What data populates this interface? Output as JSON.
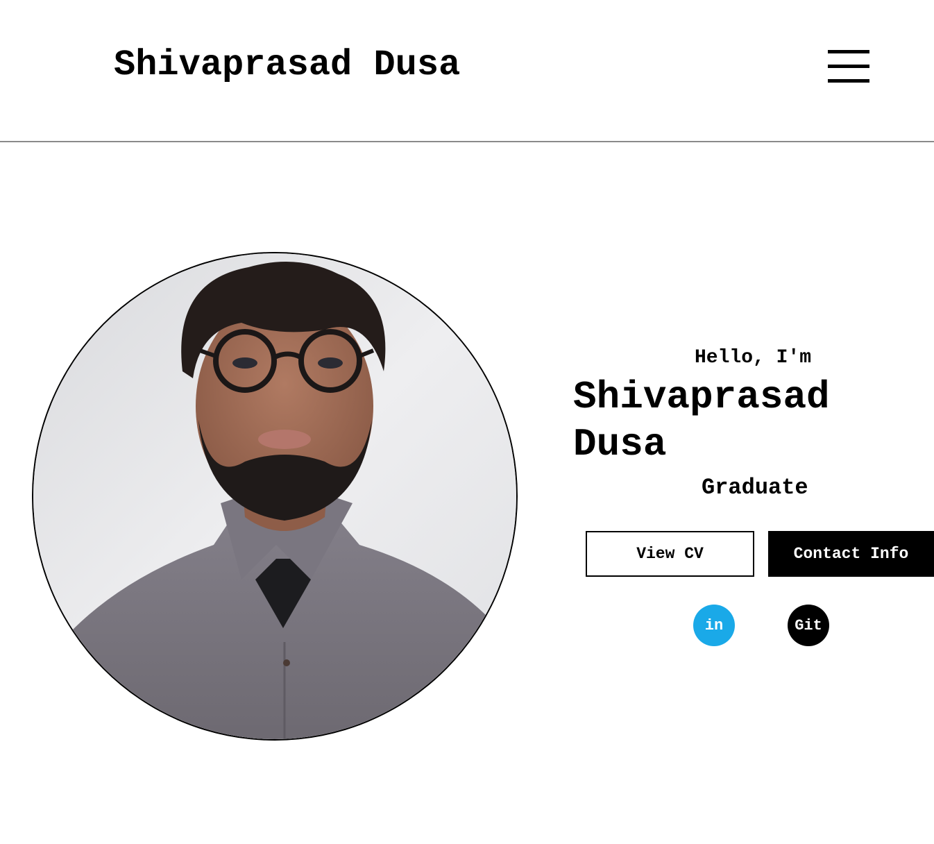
{
  "header": {
    "logo": "Shivaprasad Dusa",
    "menu_icon": "hamburger-menu-icon"
  },
  "hero": {
    "photo": "profile-photo",
    "greeting": "Hello, I'm",
    "name": "Shivaprasad Dusa",
    "role": "Graduate",
    "buttons": {
      "view_cv": "View CV",
      "contact_info": "Contact Info"
    },
    "socials": {
      "linkedin": "in",
      "github": "Git",
      "linkedin_color": "#1aa9e8",
      "github_color": "#000000"
    }
  }
}
